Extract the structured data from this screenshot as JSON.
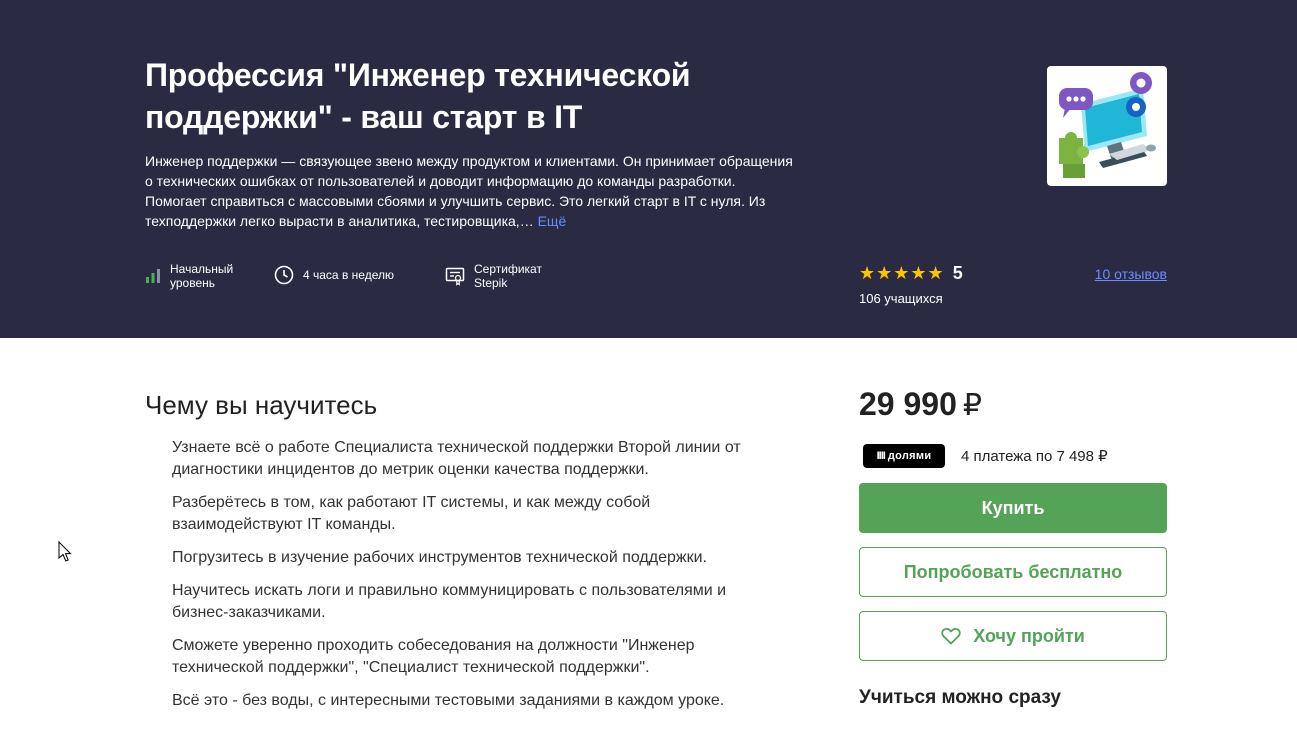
{
  "hero": {
    "title": "Профессия \"Инженер технической поддержки\" - ваш старт в IT",
    "description": "Инженер поддержки — связующее звено между продуктом и клиентами. Он принимает обращения о технических ошибках от пользователей и доводит информацию до команды разработки. Помогает справиться с массовыми сбоями и улучшить сервис. Это легкий старт в IT с нуля. Из техподдержки легко вырасти в аналитика, тестировщика,… ",
    "more_label": "Ещё",
    "meta": {
      "level_line1": "Начальный",
      "level_line2": "уровень",
      "time": "4 часа в неделю",
      "cert_line1": "Сертификат",
      "cert_line2": "Stepik"
    },
    "rating": {
      "stars": "★★★★★",
      "value": "5",
      "students": "106 учащихся",
      "reviews": "10 отзывов"
    }
  },
  "learn": {
    "title": "Чему вы научитесь",
    "items": [
      "Узнаете всё о работе Специалиста технической поддержки Второй линии от диагностики инцидентов до метрик оценки качества поддержки.",
      "Разберётесь в том, как работают IT системы, и как между собой взаимодействуют IT команды.",
      "Погрузитесь в изучение рабочих инструментов технической поддержки.",
      "Научитесь искать логи и правильно коммуницировать с пользователями и бизнес-заказчиками.",
      "Сможете уверенно проходить собеседования на должности \"Инженер технической поддержки\", \"Специалист технической поддержки\".",
      "Всё это - без воды, с интересными тестовыми заданиями в каждом уроке."
    ]
  },
  "purchase": {
    "price": "29 990",
    "currency": "₽",
    "dolyami_label": "долями",
    "installments": "4 платежа по 7 498 ₽",
    "buy_label": "Купить",
    "try_label": "Попробовать бесплатно",
    "wish_label": "Хочу пройти",
    "start_now": "Учиться можно сразу"
  },
  "colors": {
    "hero_bg": "#2a2b43",
    "accent_green": "#54a356",
    "link_blue": "#6b8cff",
    "star_yellow": "#ffc400"
  },
  "icons": [
    "level-bars-icon",
    "clock-icon",
    "certificate-icon",
    "heart-icon",
    "course-cover-image",
    "cursor-pointer-icon"
  ]
}
